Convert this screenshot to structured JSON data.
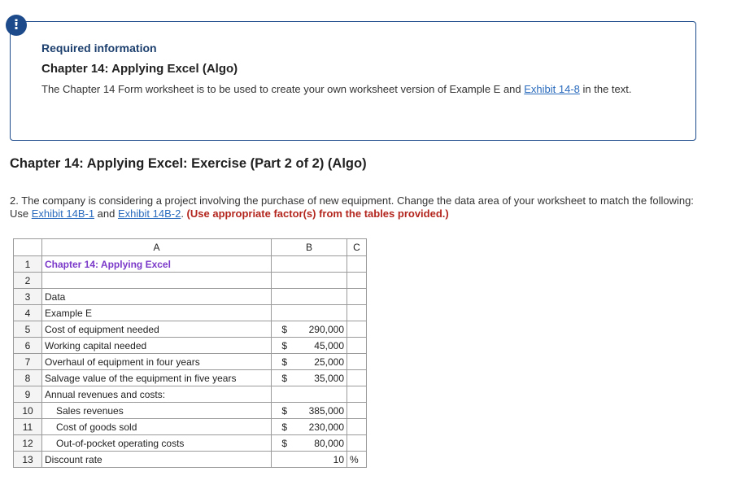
{
  "alert_icon": "!",
  "info": {
    "label": "Required information",
    "title": "Chapter 14: Applying Excel (Algo)",
    "text_before": "The Chapter 14 Form worksheet is to be used to create your own worksheet version of Example E and ",
    "link": "Exhibit 14-8",
    "text_after": " in the text."
  },
  "exercise": {
    "title": "Chapter 14: Applying Excel: Exercise (Part 2 of 2) (Algo)",
    "text_before": "2. The company is considering a project involving the purchase of new equipment. Change the data area of your worksheet to match the following: Use ",
    "link1": "Exhibit 14B-1",
    "and": " and ",
    "link2": "Exhibit 14B-2",
    "period": ". ",
    "emphasis": "(Use appropriate factor(s) from the tables provided.)"
  },
  "sheet": {
    "headers": {
      "a": "A",
      "b": "B",
      "c": "C"
    },
    "rows": [
      {
        "num": "1",
        "label": "Chapter 14: Applying Excel",
        "dollar": "",
        "value": "",
        "unit": ""
      },
      {
        "num": "2",
        "label": "",
        "dollar": "",
        "value": "",
        "unit": ""
      },
      {
        "num": "3",
        "label": "Data",
        "dollar": "",
        "value": "",
        "unit": ""
      },
      {
        "num": "4",
        "label": "Example E",
        "dollar": "",
        "value": "",
        "unit": ""
      },
      {
        "num": "5",
        "label": "Cost of equipment needed",
        "dollar": "$",
        "value": "290,000",
        "unit": ""
      },
      {
        "num": "6",
        "label": "Working capital needed",
        "dollar": "$",
        "value": "45,000",
        "unit": ""
      },
      {
        "num": "7",
        "label": "Overhaul of equipment in four years",
        "dollar": "$",
        "value": "25,000",
        "unit": ""
      },
      {
        "num": "8",
        "label": "Salvage value of the equipment in five years",
        "dollar": "$",
        "value": "35,000",
        "unit": ""
      },
      {
        "num": "9",
        "label": "Annual revenues and costs:",
        "dollar": "",
        "value": "",
        "unit": ""
      },
      {
        "num": "10",
        "label": "Sales revenues",
        "dollar": "$",
        "value": "385,000",
        "unit": ""
      },
      {
        "num": "11",
        "label": "Cost of goods sold",
        "dollar": "$",
        "value": "230,000",
        "unit": ""
      },
      {
        "num": "12",
        "label": "Out-of-pocket operating costs",
        "dollar": "$",
        "value": "80,000",
        "unit": ""
      },
      {
        "num": "13",
        "label": "Discount rate",
        "dollar": "",
        "value": "10",
        "unit": "%"
      }
    ]
  }
}
